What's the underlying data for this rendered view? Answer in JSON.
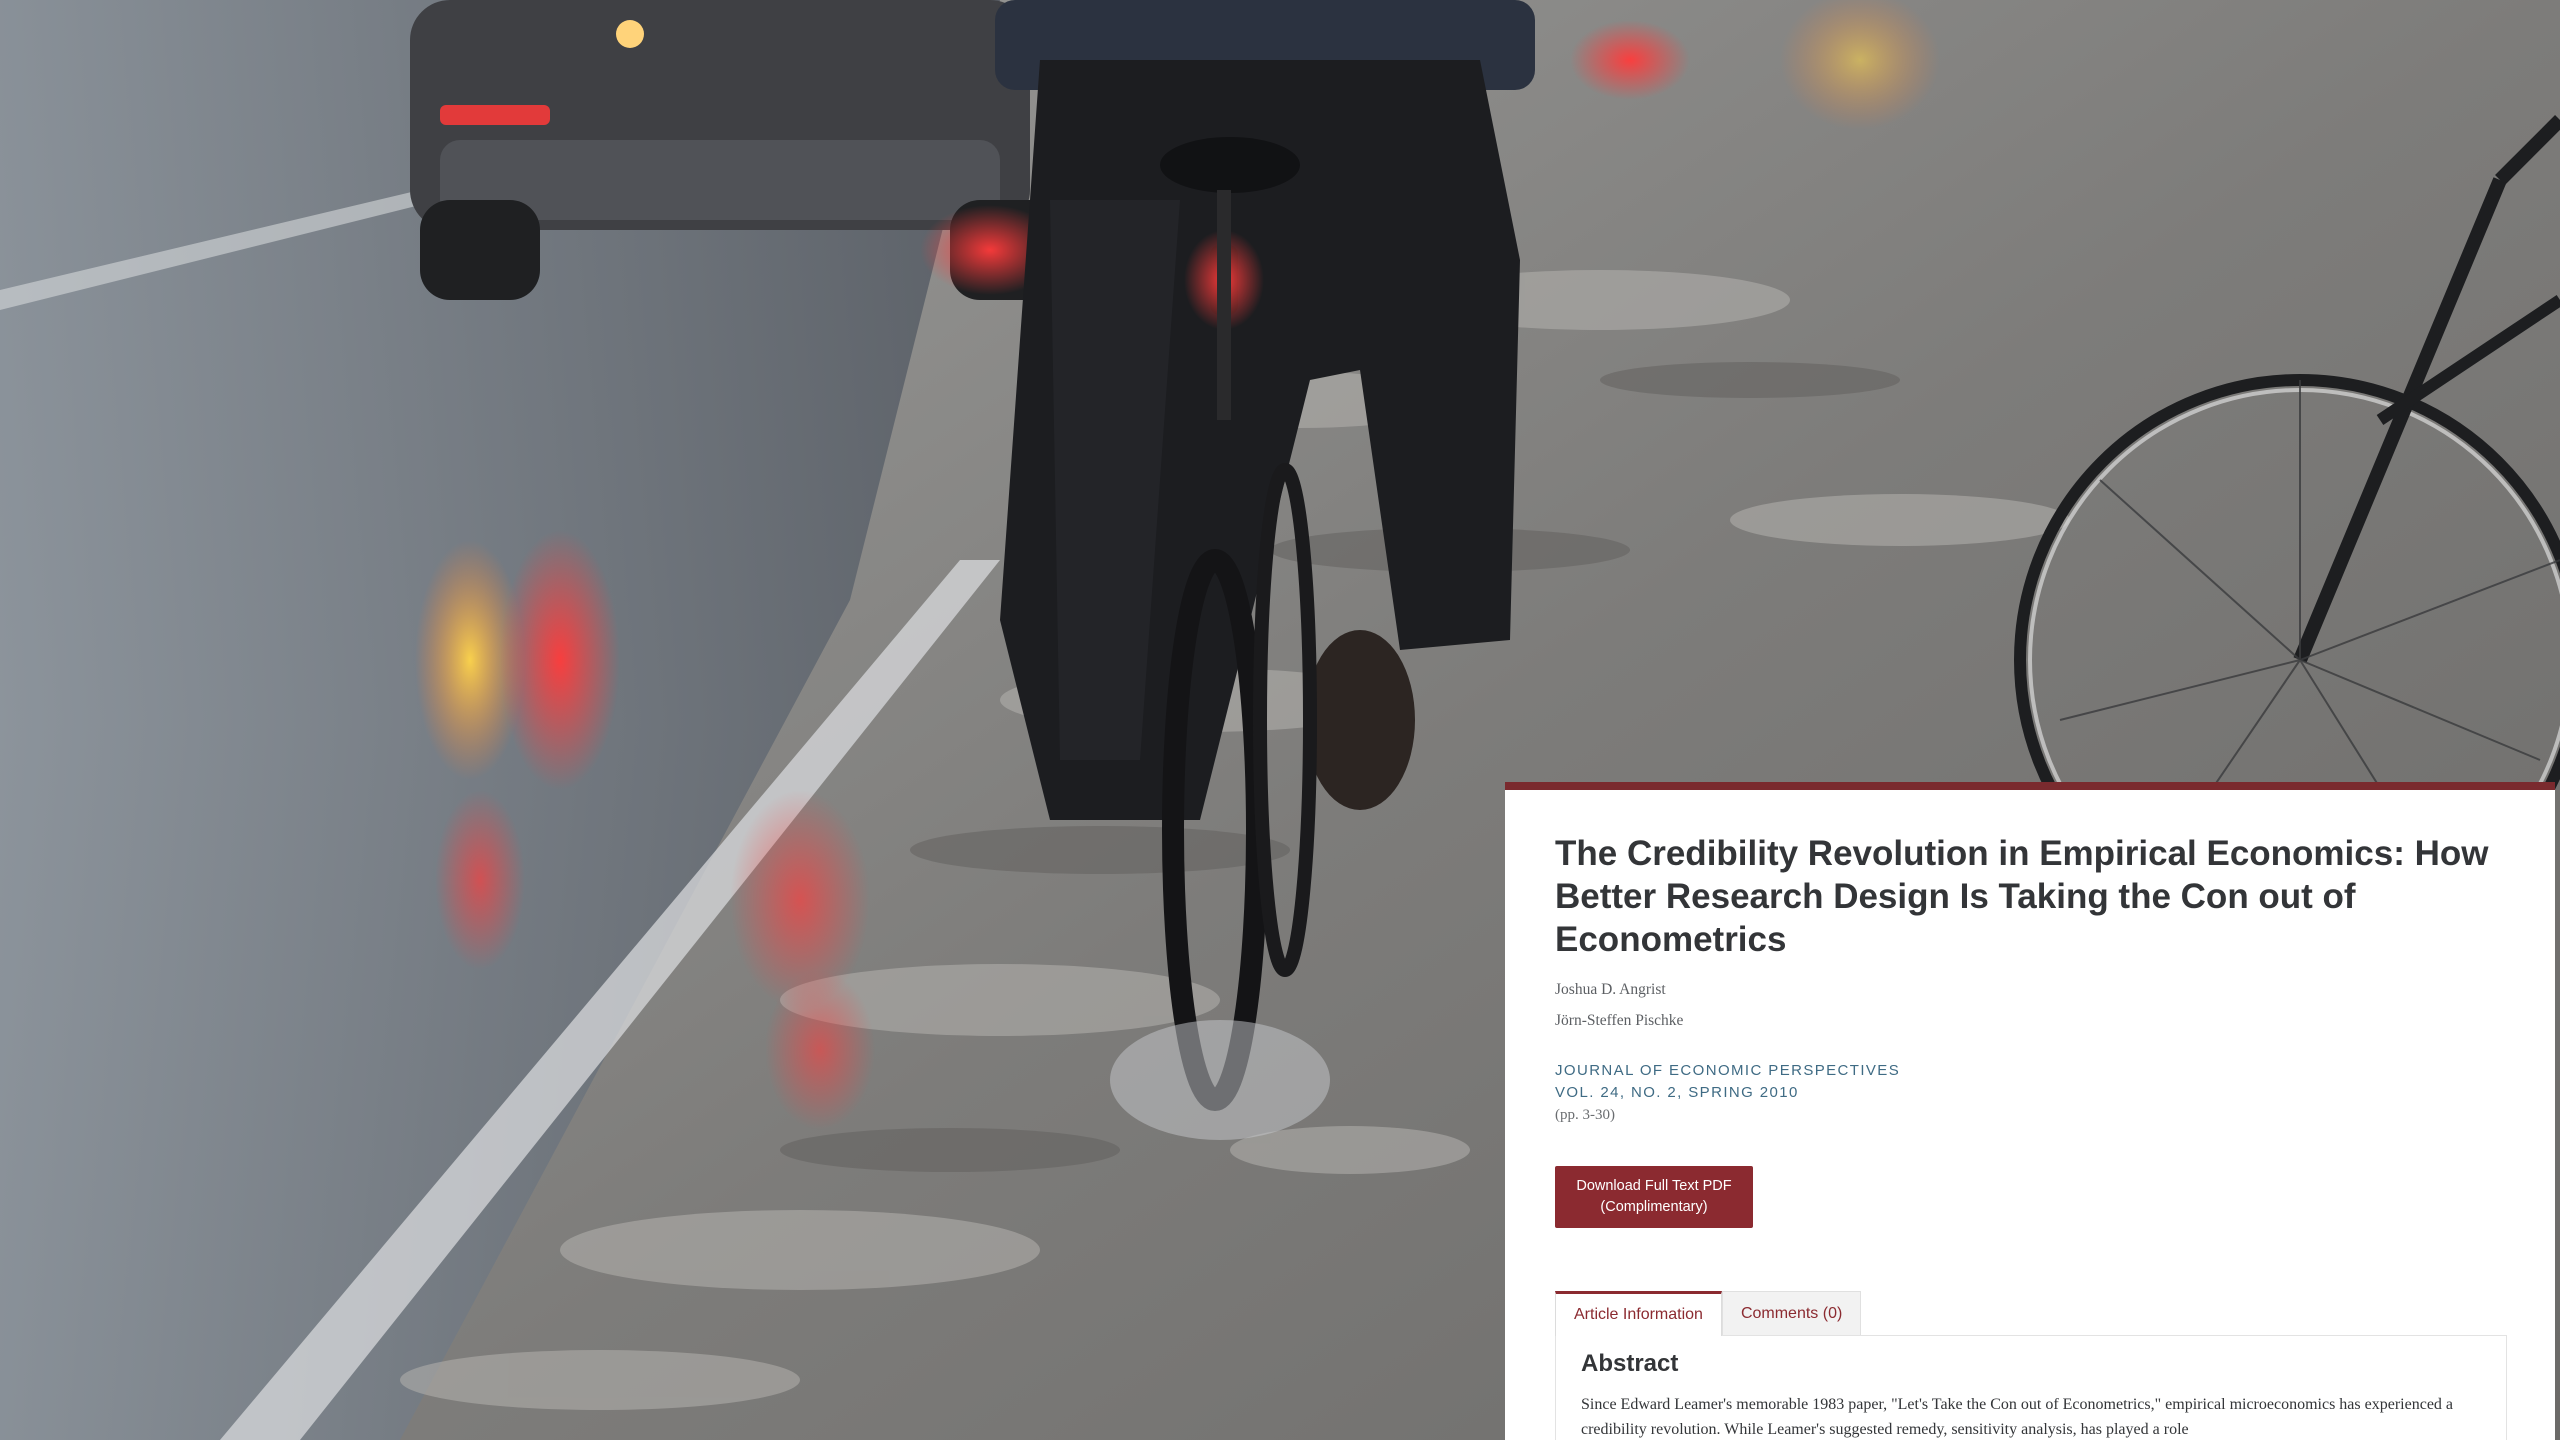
{
  "article": {
    "title": "The Credibility Revolution in Empirical Economics: How Better Research Design Is Taking the Con out of Econometrics",
    "authors": [
      "Joshua D. Angrist",
      "Jörn-Steffen Pischke"
    ],
    "journal": "Journal of Economic Perspectives",
    "volume": "Vol. 24, No. 2, Spring 2010",
    "pages": "(pp. 3-30)"
  },
  "actions": {
    "download_line1": "Download Full Text PDF",
    "download_line2": "(Complimentary)"
  },
  "tabs": [
    {
      "label": "Article Information",
      "active": true
    },
    {
      "label": "Comments (0)",
      "active": false
    }
  ],
  "abstract": {
    "heading": "Abstract",
    "text": "Since Edward Leamer's memorable 1983 paper, \"Let's Take the Con out of Econometrics,\" empirical microeconomics has experienced a credibility revolution. While Leamer's suggested remedy, sensitivity analysis, has played a role"
  },
  "colors": {
    "accent": "#8b2a30",
    "card_border": "#7a2a2e",
    "journal_text": "#3f6b84"
  }
}
